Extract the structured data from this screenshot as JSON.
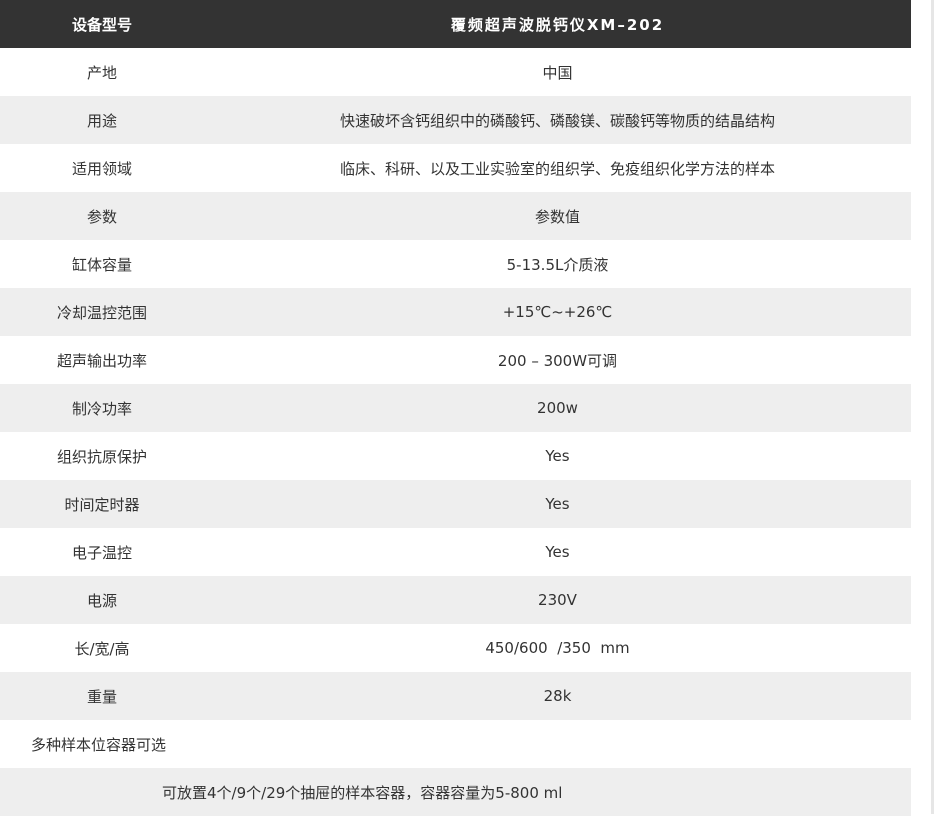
{
  "table": {
    "header": {
      "label": "设备型号",
      "value": "覆频超声波脱钙仪XM–202"
    },
    "rows": [
      {
        "label": "产地",
        "value": "中国"
      },
      {
        "label": "用途",
        "value": "快速破坏含钙组织中的磷酸钙、磷酸镁、碳酸钙等物质的结晶结构"
      },
      {
        "label": "适用领域",
        "value": "临床、科研、以及工业实验室的组织学、免疫组织化学方法的样本"
      },
      {
        "label": "参数",
        "value": "参数值"
      },
      {
        "label": "缸体容量",
        "value": "5-13.5L介质液"
      },
      {
        "label": "冷却温控范围",
        "value": "+15℃~+26℃"
      },
      {
        "label": "超声输出功率",
        "value": "200 – 300W可调"
      },
      {
        "label": "制冷功率",
        "value": "200w"
      },
      {
        "label": "组织抗原保护",
        "value": "Yes"
      },
      {
        "label": "时间定时器",
        "value": "Yes"
      },
      {
        "label": "电子温控",
        "value": "Yes"
      },
      {
        "label": "电源",
        "value": "230V"
      },
      {
        "label": "长/宽/高",
        "value": "450/600  /350  mm"
      },
      {
        "label": "重量",
        "value": "28k"
      }
    ],
    "note_title": "多种样本位容器可选",
    "note_text": "可放置4个/9个/29个抽屉的样本容器，容器容量为5-800 ml"
  }
}
